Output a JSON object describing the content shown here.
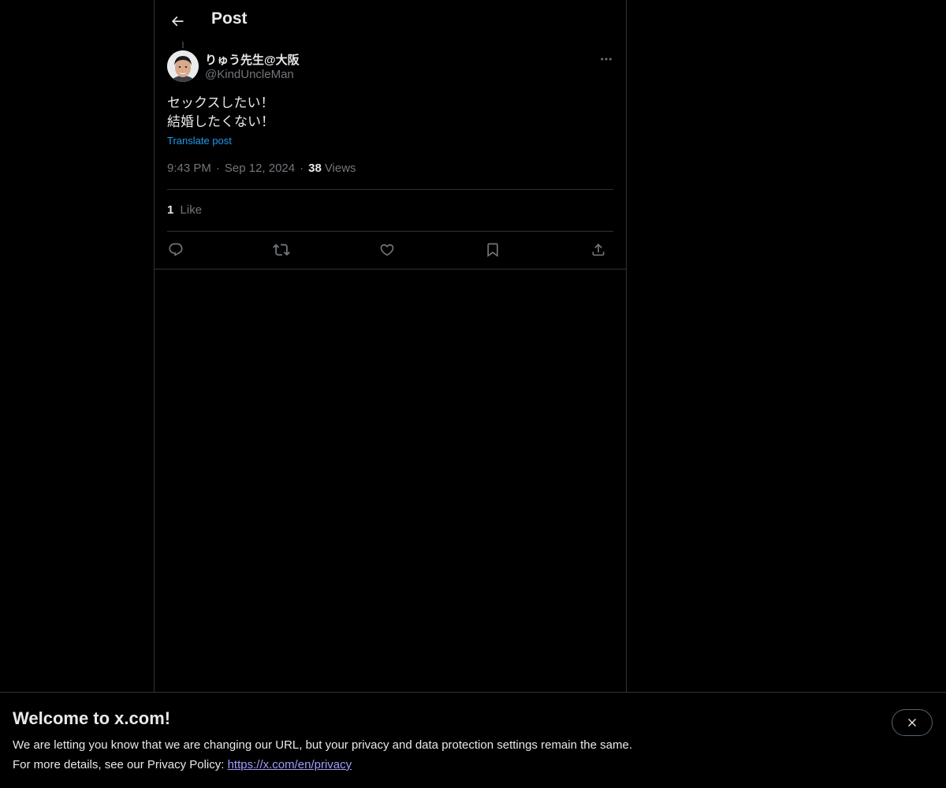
{
  "header": {
    "title": "Post",
    "back_icon": "arrow-left-icon"
  },
  "post": {
    "author": {
      "name": "りゅう先生@大阪",
      "handle": "@KindUncleMan"
    },
    "text": "セックスしたい！\n結婚したくない！",
    "translate_label": "Translate post",
    "time": "9:43 PM",
    "date": "Sep 12, 2024",
    "views_count": "38",
    "views_label": "Views",
    "likes_count": "1",
    "likes_label": "Like",
    "actions": [
      "reply-icon",
      "repost-icon",
      "like-icon",
      "bookmark-icon",
      "share-icon"
    ]
  },
  "banner": {
    "title": "Welcome to x.com!",
    "line1": "We are letting you know that we are changing our URL, but your privacy and data protection settings remain the same.",
    "line2_prefix": "For more details, see our Privacy Policy: ",
    "privacy_link": "https://x.com/en/privacy"
  },
  "colors": {
    "background": "#000000",
    "text": "#e7e9ea",
    "muted": "#71767b",
    "accent": "#1d9bf0",
    "border": "#2f3336"
  }
}
